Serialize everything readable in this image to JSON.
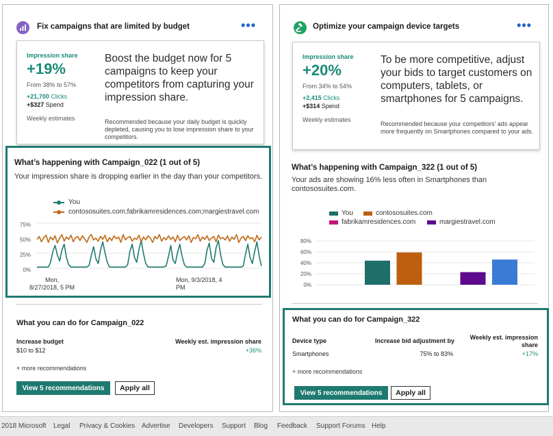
{
  "colors": {
    "accent": "#1e7a70",
    "green_text": "#1a8b78",
    "link_blue": "#2266c9",
    "left_icon_bg": "#8661c5",
    "right_icon_bg": "#21a366"
  },
  "left": {
    "header": {
      "title": "Fix campaigns that are limited by budget",
      "icon": "budget-chart-icon",
      "more": "•••"
    },
    "summary": {
      "metric_label": "Impression share",
      "metric_value": "+19%",
      "range": "From 38% to 57%",
      "clicks_value": "+21,700",
      "clicks_label": "Clicks",
      "spend_value": "+$327",
      "spend_label": "Spend",
      "note": "Weekly estimates",
      "text": "Boost the budget now for 5 campaigns to keep your competitors from capturing your impression share.",
      "reason": "Recommended because your daily budget is quickly depleted, causing you to lose impression share to your competitors."
    },
    "happening": {
      "title": "What’s happening with Campaign_022 (1 out of 5)",
      "desc": "Your impression share is dropping earlier in the day than your competitors."
    },
    "action": {
      "title": "What you can do for Campaign_022",
      "col1_header": "Increase budget",
      "col1_value": "$10 to $12",
      "col2_header": "Weekly est. impression share",
      "col2_value": "+36%",
      "more": "+ more recommendations",
      "primary_button": "View 5 recommendations",
      "secondary_button": "Apply all"
    }
  },
  "right": {
    "header": {
      "title": "Optimize your campaign device targets",
      "icon": "gavel-icon",
      "more": "•••"
    },
    "summary": {
      "metric_label": "Impression share",
      "metric_value": "+20%",
      "range": "From 34% to 54%",
      "clicks_value": "+2,415",
      "clicks_label": "Clicks",
      "spend_value": "+$314",
      "spend_label": "Spend",
      "note": "Weekly estimates",
      "text": "To be more competitive, adjust your bids to target customers on computers, tablets, or smartphones for 5 campaigns.",
      "reason": "Recommended because your competitors' ads appear more frequently on Smartphones compared to your ads."
    },
    "happening": {
      "title": "What’s happening with Campaign_322 (1 out of 5)",
      "desc": "Your ads are showing 16% less often in Smartphones than contososuites.com."
    },
    "action": {
      "title": "What you can do for Campaign_322",
      "col1_header": "Device type",
      "col1_value": "Smartphones",
      "col2_header": "Increase bid adjustment by",
      "col2_value": "75% to 83%",
      "col3_header": "Weekly est. impression share",
      "col3_value": "+17%",
      "more": "+ more recommendations",
      "primary_button": "View 5 recommendations",
      "secondary_button": "Apply all"
    }
  },
  "chart_data": [
    {
      "type": "line",
      "xlabel": "",
      "ylabel": "",
      "ylim": [
        0,
        75
      ],
      "yticks": [
        "75%",
        "50%",
        "25%",
        "0%"
      ],
      "xticks": [
        "Mon,\n8/27/2018, 5 PM",
        "Mon, 9/3/2018, 4\nPM"
      ],
      "grid": true,
      "legend": "top",
      "series": [
        {
          "name": "You",
          "color": "#1e7a70",
          "values": [
            2,
            2,
            2,
            2,
            2,
            2,
            10,
            28,
            38,
            22,
            12,
            30,
            40,
            18,
            6,
            2,
            2,
            2,
            2,
            2,
            2,
            2,
            2,
            5,
            22,
            36,
            16,
            8,
            30,
            44,
            26,
            10,
            2,
            2,
            2,
            2,
            2,
            2,
            2,
            2,
            6,
            28,
            40,
            18,
            10,
            32,
            46,
            24,
            8,
            2,
            2,
            2,
            2,
            2,
            2,
            2,
            2,
            4,
            20,
            38,
            14,
            8,
            26,
            40,
            20,
            6,
            2,
            2,
            2,
            2,
            2,
            2,
            2,
            2,
            8,
            30,
            42,
            16,
            10,
            34,
            46,
            22,
            6,
            2,
            2,
            2,
            2,
            2,
            2,
            2,
            2,
            4,
            24,
            40,
            18,
            8,
            28,
            44,
            20,
            4
          ]
        },
        {
          "name": "contososuites.com;fabrikamresidences.com;margiestravel.com",
          "color": "#c06a14",
          "values": [
            48,
            53,
            44,
            51,
            55,
            43,
            52,
            47,
            54,
            42,
            50,
            56,
            45,
            52,
            48,
            55,
            44,
            51,
            53,
            46,
            54,
            49,
            43,
            52,
            56,
            47,
            50,
            45,
            53,
            48,
            55,
            44,
            51,
            46,
            54,
            49,
            52,
            43,
            56,
            47,
            51,
            53,
            45,
            50,
            48,
            55,
            44,
            52,
            47,
            54,
            50,
            43,
            53,
            49,
            56,
            45,
            51,
            47,
            54,
            48,
            52,
            44,
            55,
            46,
            50,
            53,
            47,
            54,
            43,
            51,
            49,
            56,
            45,
            52,
            48,
            54,
            46,
            50,
            53,
            44,
            55,
            49,
            51,
            47,
            54,
            45,
            52,
            48,
            56,
            43,
            50,
            53,
            46,
            54,
            49,
            51,
            44,
            55,
            47,
            52
          ]
        }
      ]
    },
    {
      "type": "bar",
      "xlabel": "",
      "ylabel": "",
      "ylim": [
        0,
        80
      ],
      "yticks": [
        "80%",
        "60%",
        "40%",
        "20%",
        "0%"
      ],
      "grid": true,
      "legend": "top",
      "series": [
        {
          "name": "You",
          "color": "#1e6f6a",
          "values": [
            44
          ]
        },
        {
          "name": "contososuites.com",
          "color": "#bd5f0e",
          "values": [
            59
          ]
        },
        {
          "name": "fabrikamresidences.com",
          "color": "#c4177c",
          "values": [
            0
          ]
        },
        {
          "name": "margiestravel.com",
          "color": "#5d0a8c",
          "values": [
            23
          ]
        },
        {
          "name": "",
          "color": "#3a7bd5",
          "values": [
            46
          ]
        }
      ]
    }
  ],
  "footer": {
    "items": [
      "2018 Microsoft",
      "Legal",
      "Privacy & Cookies",
      "Advertise",
      "Developers",
      "Support",
      "Blog",
      "Feedback",
      "Support Forums",
      "Help"
    ]
  }
}
